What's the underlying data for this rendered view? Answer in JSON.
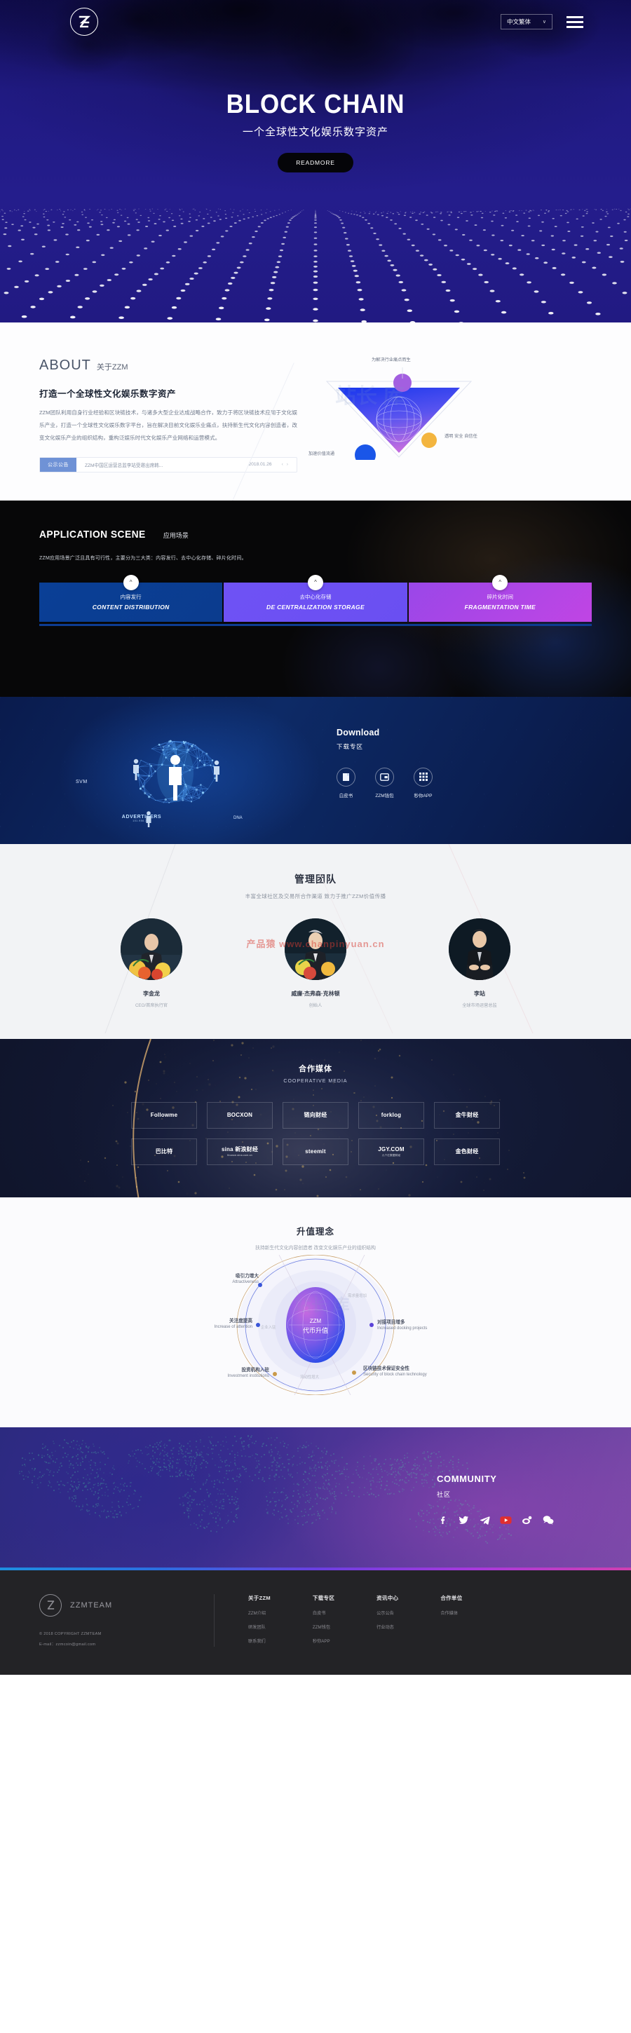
{
  "header": {
    "logo_text": "Z",
    "language": "中文繁体",
    "chevron": "∨",
    "menu_icon": "hamburger-icon"
  },
  "hero": {
    "title": "BLOCK CHAIN",
    "subtitle": "一个全球性文化娱乐数字资产",
    "cta": "READMORE"
  },
  "about": {
    "kicker_en": "ABOUT",
    "kicker_cn": "关于ZZM",
    "heading": "打造一个全球性文化娱乐数字资产",
    "paragraph": "ZZM团队利用自身行业经验和区块链技术，与诸多大型企业达成战略合作，致力于将区块链技术应用于文化娱乐产业，打造一个全球性文化娱乐数字平台，旨在解决目前文化娱乐业痛点，扶持新生代文化内容创造者，改变文化娱乐产业的组织结构，重构泛娱乐时代文化娱乐产业网络和运营模式。",
    "notice": {
      "tag": "公示公告",
      "title": "ZZM中国区运营总监李站受邀出席韩...",
      "date": "2018.01.26",
      "prev": "‹",
      "next": "›"
    },
    "diagram": {
      "top_label": "为解决行业痛点而生",
      "right_label": "透明 安全 自信任",
      "left_label": "加速价值流通"
    },
    "watermark": "站长 库"
  },
  "scene": {
    "kicker_en": "APPLICATION SCENE",
    "kicker_cn": "应用场景",
    "description": "ZZM应用场景广泛且具有可行性，主要分为三大类：内容发行、去中心化存储、碎片化时间。",
    "cards": [
      {
        "cn": "内容发行",
        "en": "CONTENT DISTRIBUTION",
        "bubble": "^"
      },
      {
        "cn": "去中心化存储",
        "en": "DE CENTRALIZATION STORAGE",
        "bubble": "^"
      },
      {
        "cn": "碎片化时间",
        "en": "FRAGMENTATION TIME",
        "bubble": "^"
      }
    ]
  },
  "download": {
    "title": "Download",
    "subtitle": "下载专区",
    "svm_label": "SVM",
    "advertisers_label": "ADVERTISERS",
    "advertisers_ip": "101.956.338",
    "dna_label": "DNA",
    "items": [
      {
        "label": "白皮书",
        "icon": "book-icon"
      },
      {
        "label": "ZZM钱包",
        "icon": "wallet-icon"
      },
      {
        "label": "秒你APP",
        "icon": "grid-apps-icon"
      }
    ]
  },
  "team": {
    "title": "管理团队",
    "subtitle": "丰富全球社区及交易所合作渠道 致力于推广ZZM价值传播",
    "watermark": "产品猿 www.chanpinyuan.cn",
    "members": [
      {
        "name": "李金龙",
        "role": "CEO/首席执行官"
      },
      {
        "name": "威廉·杰弗森·克林顿",
        "role": "创始人"
      },
      {
        "name": "李站",
        "role": "全球市场运营总监"
      }
    ]
  },
  "media": {
    "title": "合作媒体",
    "subtitle": "COOPERATIVE MEDIA",
    "logos": [
      {
        "name": "Followme",
        "sub": ""
      },
      {
        "name": "BOCXON",
        "sub": ""
      },
      {
        "name": "链向财经",
        "sub": ""
      },
      {
        "name": "forklog",
        "sub": ""
      },
      {
        "name": "金牛财经",
        "sub": ""
      },
      {
        "name": "巴比特",
        "sub": ""
      },
      {
        "name": "sina 新浪财经",
        "sub": "finance.sina.com.cn"
      },
      {
        "name": "steemit",
        "sub": ""
      },
      {
        "name": "JGY.COM",
        "sub": "九个亿数据财经"
      },
      {
        "name": "金色财经",
        "sub": ""
      }
    ]
  },
  "value": {
    "title": "升值理念",
    "subtitle": "扶持新生代文化内容创造者 改变文化娱乐产业的组织结构",
    "core_top": "ZZM",
    "core_bottom": "代币升值",
    "inner_labels": [
      "需求量增加",
      "企业入驻",
      "流动性增大"
    ],
    "nodes": [
      {
        "cn": "吸引力增大",
        "en": "Attractiveness"
      },
      {
        "cn": "对接项目增多",
        "en": "Increased docking projects"
      },
      {
        "cn": "区块链技术保证安全性",
        "en": "Security of block chain technology"
      },
      {
        "cn": "投资机构入驻",
        "en": "Investment institutions"
      },
      {
        "cn": "关注度提高",
        "en": "Increase of attention"
      }
    ],
    "watermark": "站长 库"
  },
  "community": {
    "title": "COMMUNITY",
    "subtitle": "社区",
    "icons": [
      "facebook-icon",
      "twitter-icon",
      "telegram-icon",
      "youtube-icon",
      "weibo-icon",
      "wechat-icon"
    ]
  },
  "footer": {
    "brand": "ZZMTEAM",
    "logo_text": "Z",
    "copyright": "© 2018 COPYRIGHT ZZMTEAM",
    "email": "E-mail：zzmcoin@gmail.com",
    "columns": [
      {
        "title": "关于ZZM",
        "links": [
          "ZZM介绍",
          "研发团队",
          "联系我们"
        ]
      },
      {
        "title": "下载专区",
        "links": [
          "白皮书",
          "ZZM钱包",
          "秒你APP"
        ]
      },
      {
        "title": "资讯中心",
        "links": [
          "公示公告",
          "行业动态"
        ]
      },
      {
        "title": "合作单位",
        "links": [
          "合作媒体"
        ]
      }
    ]
  }
}
